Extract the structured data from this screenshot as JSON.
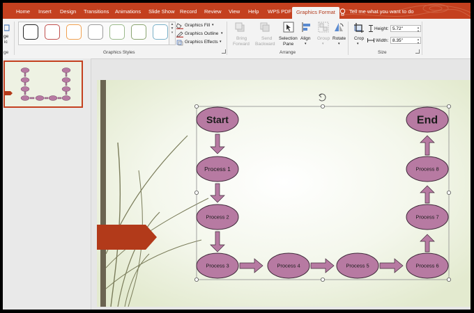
{
  "tabs": [
    "Home",
    "Insert",
    "Design",
    "Transitions",
    "Animations",
    "Slide Show",
    "Record",
    "Review",
    "View",
    "Help",
    "WPS PDF",
    "Graphics Format"
  ],
  "tell_me": "Tell me what you want to do",
  "ribbon": {
    "left_cut_1": "ge",
    "left_cut_2": "ic",
    "left_cut_3": "ge",
    "graphics_fill": "Graphics Fill",
    "graphics_outline": "Graphics Outline",
    "graphics_effects": "Graphics Effects",
    "graphics_styles_label": "Graphics Styles",
    "bring_forward_1": "Bring",
    "bring_forward_2": "Forward",
    "send_backward_1": "Send",
    "send_backward_2": "Backward",
    "selection_pane_1": "Selection",
    "selection_pane_2": "Pane",
    "align": "Align",
    "group": "Group",
    "rotate": "Rotate",
    "arrange_label": "Arrange",
    "crop": "Crop",
    "height_label": "Height:",
    "height_value": "5.72\"",
    "width_label": "Width:",
    "width_value": "8.35\"",
    "size_label": "Size",
    "style_colors": [
      "#222222",
      "#c0504d",
      "#f0a050",
      "#9a9a9a",
      "#9ab98a",
      "#8aa470",
      "#7ab0c8"
    ]
  },
  "thumbnail": {
    "slide_number": "1"
  },
  "flowchart": {
    "start": "Start",
    "end": "End",
    "process_1": "Process 1",
    "process_2": "Process 2",
    "process_3": "Process 3",
    "process_4": "Process 4",
    "process_5": "Process 5",
    "process_6": "Process 6",
    "process_7": "Process 7",
    "process_8": "Process 8",
    "shape_color": "#b77aa2",
    "arrow_color": "#b77aa2"
  },
  "colors": {
    "accent": "#c4401f",
    "slide_bg": "#eef2e3",
    "banner": "#b23a1a"
  }
}
